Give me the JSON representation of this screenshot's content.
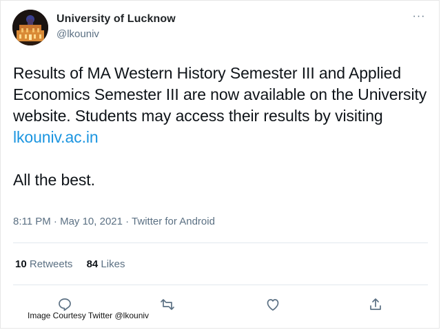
{
  "account": {
    "display_name": "University of Lucknow",
    "handle": "@lkouniv"
  },
  "header": {
    "more_label": "···"
  },
  "tweet": {
    "text_before_link": "Results of MA Western History Semester III and Applied Economics Semester III are now available on the University website. Students may access their results by visiting ",
    "link_text": "lkouniv.ac.in",
    "closing": "All the best.",
    "timestamp": "8:11 PM · May 10, 2021 · Twitter for Android"
  },
  "stats": {
    "retweets_count": "10",
    "retweets_label": "Retweets",
    "likes_count": "84",
    "likes_label": "Likes"
  },
  "actions": [
    "reply-icon",
    "retweet-icon",
    "like-icon",
    "share-icon"
  ],
  "colors": {
    "link": "#1b95e0",
    "secondary_text": "#5b7083",
    "primary_text": "#0f1419"
  },
  "caption": "Image Courtesy Twitter @lkouniv"
}
